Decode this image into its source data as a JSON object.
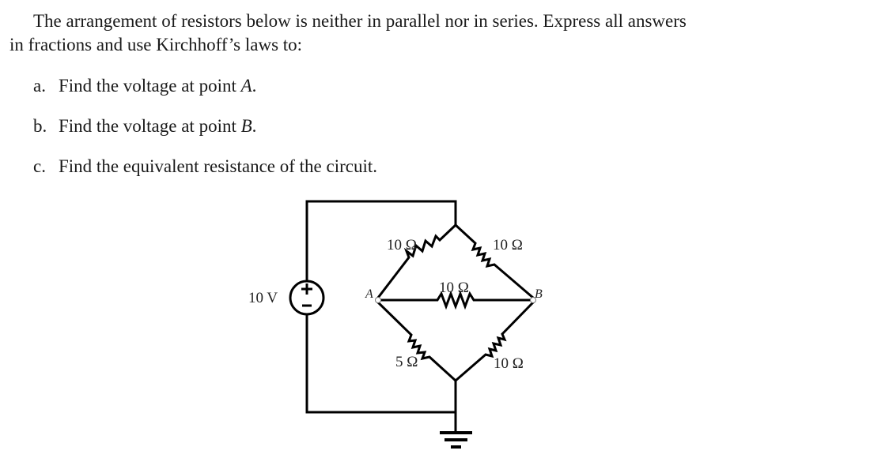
{
  "problem": {
    "intro_line1": "The arrangement of resistors below is neither in parallel nor in series. Express all answers",
    "intro_line2": "in fractions and use Kirchhoff’s laws to:",
    "items": [
      {
        "label": "a.",
        "text": "Find the voltage at point ",
        "var": "A",
        "end": "."
      },
      {
        "label": "b.",
        "text": "Find the voltage at point ",
        "var": "B",
        "end": "."
      },
      {
        "label": "c.",
        "text": "Find the equivalent resistance of the circuit.",
        "var": "",
        "end": ""
      }
    ]
  },
  "circuit": {
    "source_label": "10 V",
    "source_plus": "+",
    "source_minus": "–",
    "node_a": "A",
    "node_b": "B",
    "r_top_left": "10 Ω",
    "r_top_right": "10 Ω",
    "r_middle": "10 Ω",
    "r_bottom_left": "5 Ω",
    "r_bottom_right": "10 Ω"
  }
}
